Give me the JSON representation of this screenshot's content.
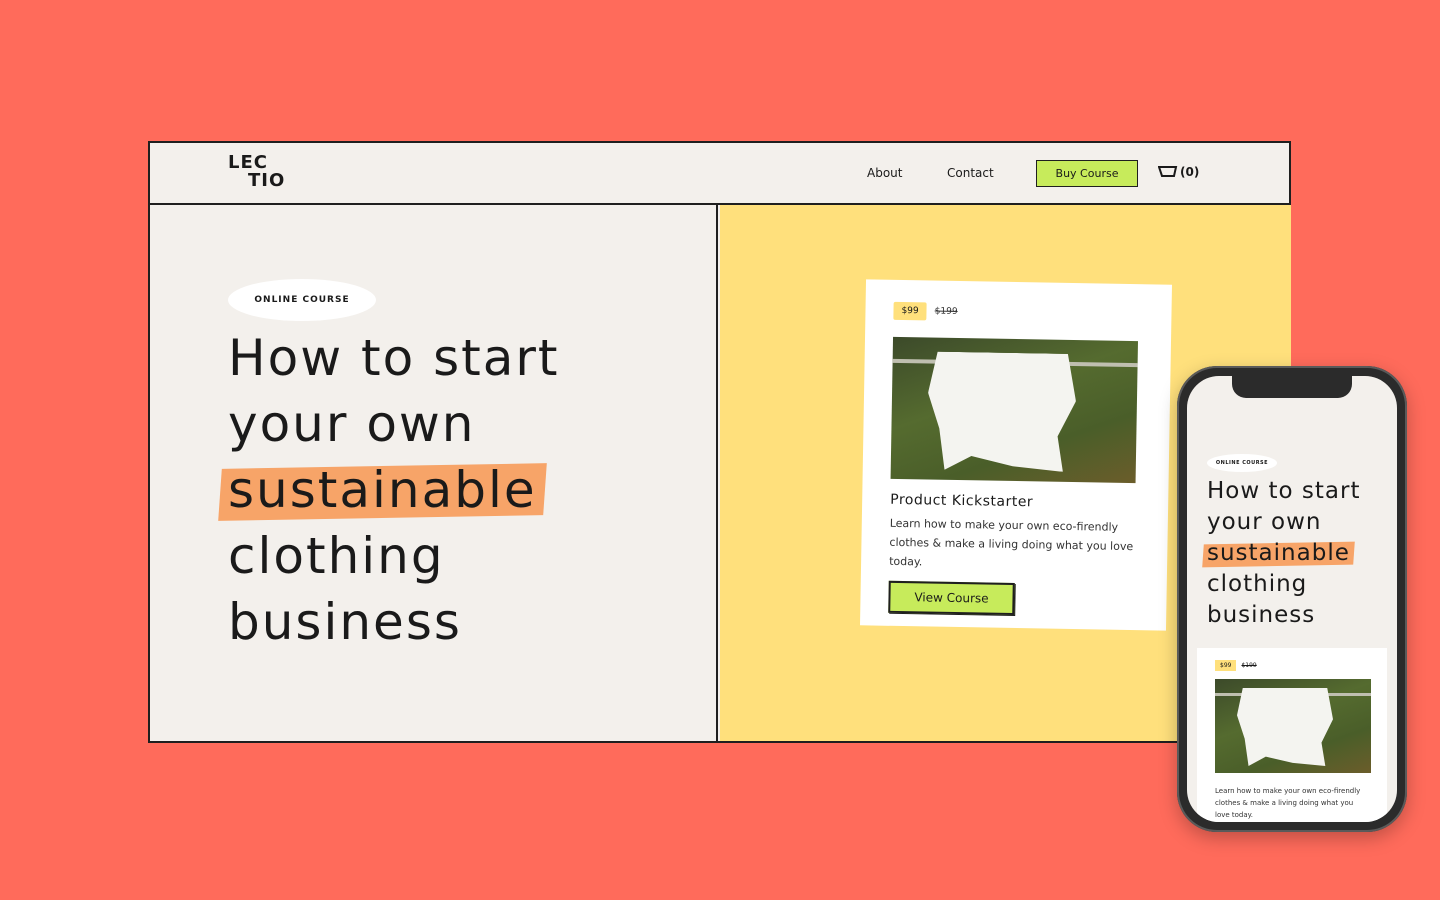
{
  "brand": {
    "logo_line1": "LEC",
    "logo_line2": "TIO"
  },
  "nav": {
    "about": "About",
    "contact": "Contact",
    "buy_button": "Buy Course",
    "cart_count": "(0)",
    "cart_icon": "cart-icon"
  },
  "hero": {
    "badge": "ONLINE COURSE",
    "line1": "How to start",
    "line2": "your own",
    "highlight": "sustainable",
    "line4": "clothing",
    "line5": "business"
  },
  "card": {
    "price": "$99",
    "old_price": "$199",
    "title": "Product Kickstarter",
    "description": "Learn how to make your own eco-firendly clothes & make a living doing what you love today.",
    "button": "View Course"
  },
  "mobile": {
    "badge": "ONLINE COURSE",
    "line1": "How to start",
    "line2": "your own",
    "highlight": "sustainable",
    "line4": "clothing",
    "line5": "business",
    "price": "$99",
    "old_price": "$199",
    "description": "Learn how to make your own eco-firendly clothes & make a living doing what you love today."
  },
  "colors": {
    "background": "#FF6B5B",
    "panel": "#F3F0EC",
    "yellow": "#FFE07C",
    "lime": "#C7EB5B",
    "highlight": "#F7A468"
  }
}
